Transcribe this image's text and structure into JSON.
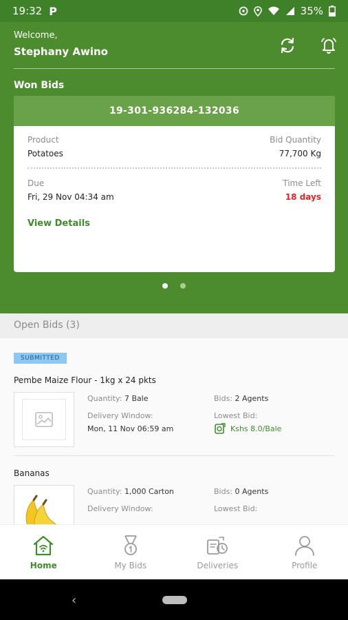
{
  "status_bar": {
    "time": "19:32",
    "app_icon": "P",
    "battery": "35%"
  },
  "header": {
    "welcome": "Welcome,",
    "user_name": "Stephany Awino",
    "won_bids_title": "Won Bids"
  },
  "won_bid_card": {
    "bid_id": "19-301-936284-132036",
    "product_label": "Product",
    "product_value": "Potatoes",
    "quantity_label": "Bid Quantity",
    "quantity_value": "77,700 Kg",
    "due_label": "Due",
    "due_value": "Fri, 29 Nov 04:34 am",
    "time_left_label": "Time Left",
    "time_left_value": "18 days",
    "view_details": "View Details"
  },
  "carousel": {
    "pages": 2,
    "active": 0
  },
  "open_bids": {
    "title": "Open Bids (3)",
    "items": [
      {
        "status": "SUBMITTED",
        "name": "Pembe Maize Flour - 1kg x 24 pkts",
        "quantity_label": "Quantity:",
        "quantity_value": "7 Bale",
        "bids_label": "Bids:",
        "bids_value": "2 Agents",
        "window_label": "Delivery Window:",
        "window_value": "Mon, 11 Nov 06:59 am",
        "lowest_label": "Lowest Bid:",
        "lowest_value": "Kshs 8.0/Bale"
      },
      {
        "name": "Bananas",
        "quantity_label": "Quantity:",
        "quantity_value": "1,000 Carton",
        "bids_label": "Bids:",
        "bids_value": "0 Agents",
        "window_label": "Delivery Window:",
        "lowest_label": "Lowest Bid:"
      }
    ]
  },
  "bottom_nav": [
    {
      "label": "Home",
      "icon": "home-icon",
      "active": true
    },
    {
      "label": "My Bids",
      "icon": "medal-icon",
      "active": false
    },
    {
      "label": "Deliveries",
      "icon": "deliveries-icon",
      "active": false
    },
    {
      "label": "Profile",
      "icon": "profile-icon",
      "active": false
    }
  ],
  "colors": {
    "brand_green": "#4c8c2f",
    "card_header": "#6aa249",
    "accent_green": "#3f8c2c",
    "alert_red": "#e02424",
    "badge_blue": "#8ec8f0"
  }
}
